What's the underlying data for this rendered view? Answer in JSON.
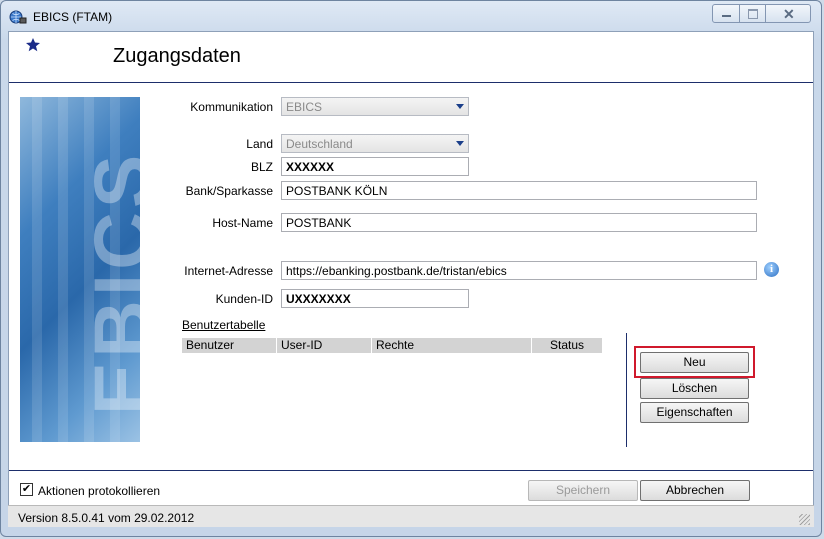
{
  "window": {
    "title": "EBICS (FTAM)"
  },
  "header": {
    "title": "Zugangsdaten"
  },
  "form": {
    "kommunikation": {
      "label": "Kommunikation",
      "value": "EBICS"
    },
    "land": {
      "label": "Land",
      "value": "Deutschland"
    },
    "blz": {
      "label": "BLZ",
      "value": "XXXXXX"
    },
    "bank": {
      "label": "Bank/Sparkasse",
      "value": "POSTBANK KÖLN"
    },
    "host": {
      "label": "Host-Name",
      "value": "POSTBANK"
    },
    "internet": {
      "label": "Internet-Adresse",
      "value": "https://ebanking.postbank.de/tristan/ebics"
    },
    "kunden": {
      "label": "Kunden-ID",
      "value": "UXXXXXXX"
    }
  },
  "user_table": {
    "title": "Benutzertabelle",
    "columns": [
      "Benutzer",
      "User-ID",
      "Rechte",
      "Status"
    ],
    "rows": []
  },
  "buttons": {
    "neu": "Neu",
    "loeschen": "Löschen",
    "eigenschaften": "Eigenschaften",
    "speichern": "Speichern",
    "abbrechen": "Abbrechen"
  },
  "options": {
    "log_actions": {
      "label": "Aktionen protokollieren",
      "checked": true
    }
  },
  "statusbar": {
    "version": "Version 8.5.0.41 vom 29.02.2012"
  },
  "image": {
    "text": "EBICS"
  },
  "icons": {
    "app": "globe-network-icon",
    "header": "star-icon",
    "info": "info-icon"
  },
  "colors": {
    "highlight": "#d0192c",
    "header_line": "#1d2e6b"
  }
}
